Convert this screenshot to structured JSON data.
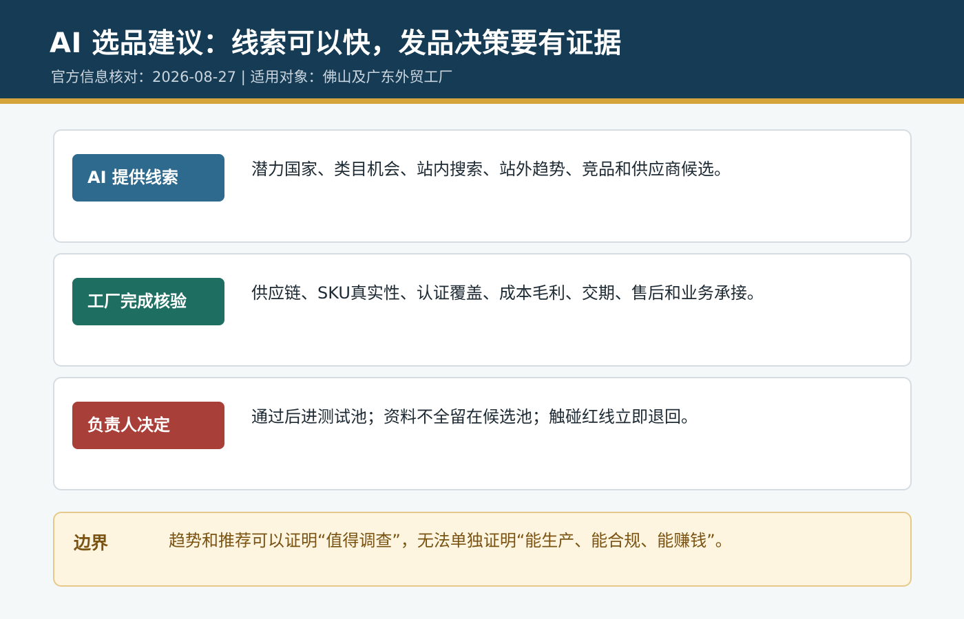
{
  "header": {
    "title": "AI 选品建议：线索可以快，发品决策要有证据",
    "subtitle": "官方信息核对：2026-08-27 | 适用对象：佛山及广东外贸工厂"
  },
  "cards": [
    {
      "label": "AI 提供线索",
      "text": "潜力国家、类目机会、站内搜索、站外趋势、竞品和供应商候选。",
      "color": "#2e6a8e"
    },
    {
      "label": "工厂完成核验",
      "text": "供应链、SKU真实性、认证覆盖、成本毛利、交期、售后和业务承接。",
      "color": "#1f6e62"
    },
    {
      "label": "负责人决定",
      "text": "通过后进测试池；资料不全留在候选池；触碰红线立即退回。",
      "color": "#a83f38"
    }
  ],
  "boundary": {
    "label": "边界",
    "text": "趋势和推荐可以证明“值得调查”，无法单独证明“能生产、能合规、能赚钱”。"
  }
}
